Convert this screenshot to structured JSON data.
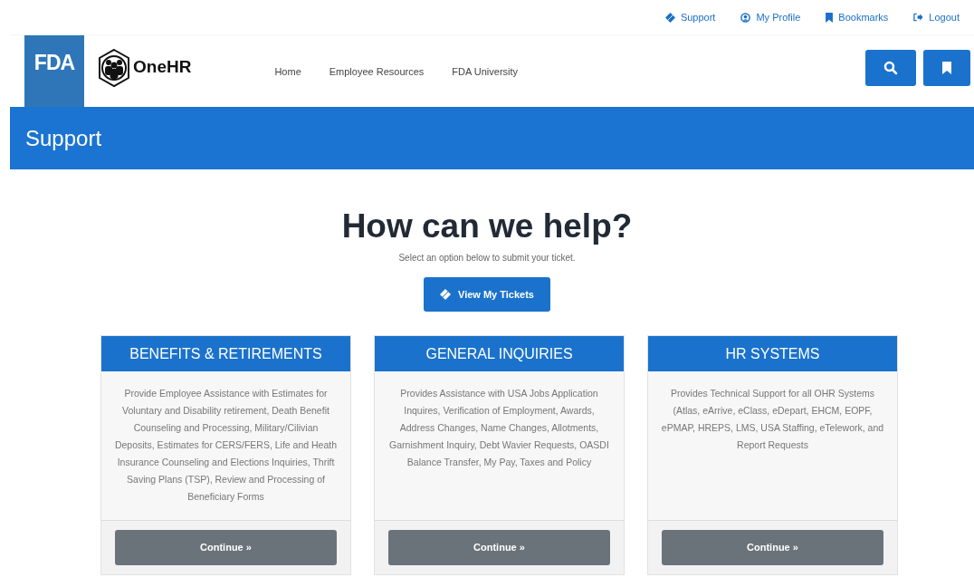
{
  "top_links": [
    {
      "kind": "ticket",
      "label": "Support"
    },
    {
      "kind": "profile",
      "label": "My Profile"
    },
    {
      "kind": "bookmark",
      "label": "Bookmarks"
    },
    {
      "kind": "logout",
      "label": "Logout"
    }
  ],
  "header": {
    "agency_logo": "FDA",
    "app_logo": "OneHR",
    "nav": [
      "Home",
      "Employee Resources",
      "FDA University"
    ]
  },
  "banner": {
    "title": "Support"
  },
  "main": {
    "heading": "How can we help?",
    "subtitle": "Select an option below to submit your ticket.",
    "button": "View My Tickets"
  },
  "cards": [
    {
      "title": "BENEFITS & RETIREMENTS",
      "description": "Provide Employee Assistance with Estimates for Voluntary and Disability retirement, Death Benefit Counseling and Processing, Military/Cilivian Deposits, Estimates for CERS/FERS, Life and Heath Insurance Counseling and Elections Inquiries, Thrift Saving Plans (TSP), Review and Processing of Beneficiary Forms",
      "button": "Continue »"
    },
    {
      "title": "GENERAL INQUIRIES",
      "description": "Provides Assistance with USA Jobs Application Inquires, Verification of Employment, Awards, Address Changes, Name Changes, Allotments, Garnishment Inquiry, Debt Wavier Requests, OASDI Balance Transfer, My Pay, Taxes and Policy",
      "button": "Continue »"
    },
    {
      "title": "HR SYSTEMS",
      "description": "Provides Technical Support for all OHR Systems (Atlas, eArrive, eClass, eDepart, EHCM, EOPF, ePMAP, HREPS, LMS, USA Staffing, eTelework, and Report Requests",
      "button": "Continue »"
    }
  ]
}
